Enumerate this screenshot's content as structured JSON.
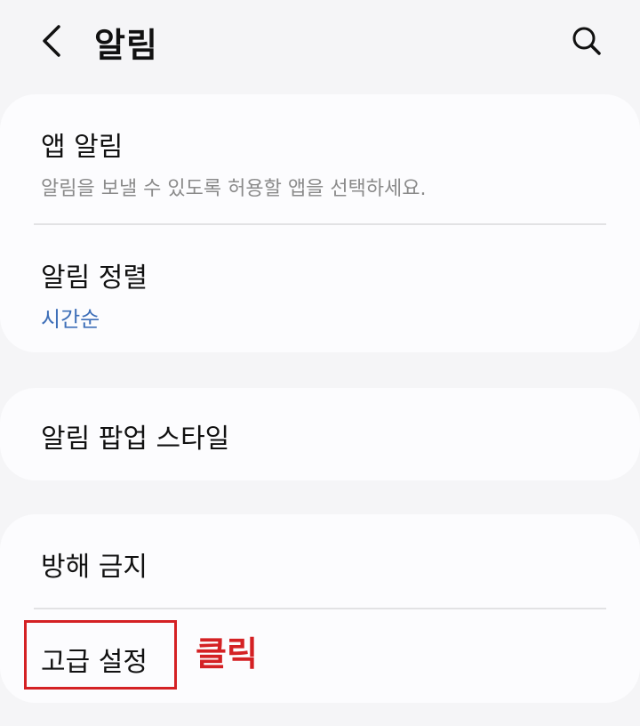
{
  "header": {
    "title": "알림",
    "back_icon": "chevron-left-icon",
    "search_icon": "search-icon"
  },
  "sections": [
    {
      "items": [
        {
          "title": "앱 알림",
          "subtitle": "알림을 보낼 수 있도록 허용할 앱을 선택하세요."
        },
        {
          "title": "알림 정렬",
          "value": "시간순"
        }
      ]
    },
    {
      "items": [
        {
          "title": "알림 팝업 스타일"
        }
      ]
    },
    {
      "items": [
        {
          "title": "방해 금지"
        },
        {
          "title": "고급 설정"
        }
      ]
    }
  ],
  "annotation": {
    "label": "클릭",
    "color": "#d42124"
  },
  "colors": {
    "accent": "#3e6fb8",
    "background": "#f5f5f7",
    "card": "#fcfcfe"
  }
}
